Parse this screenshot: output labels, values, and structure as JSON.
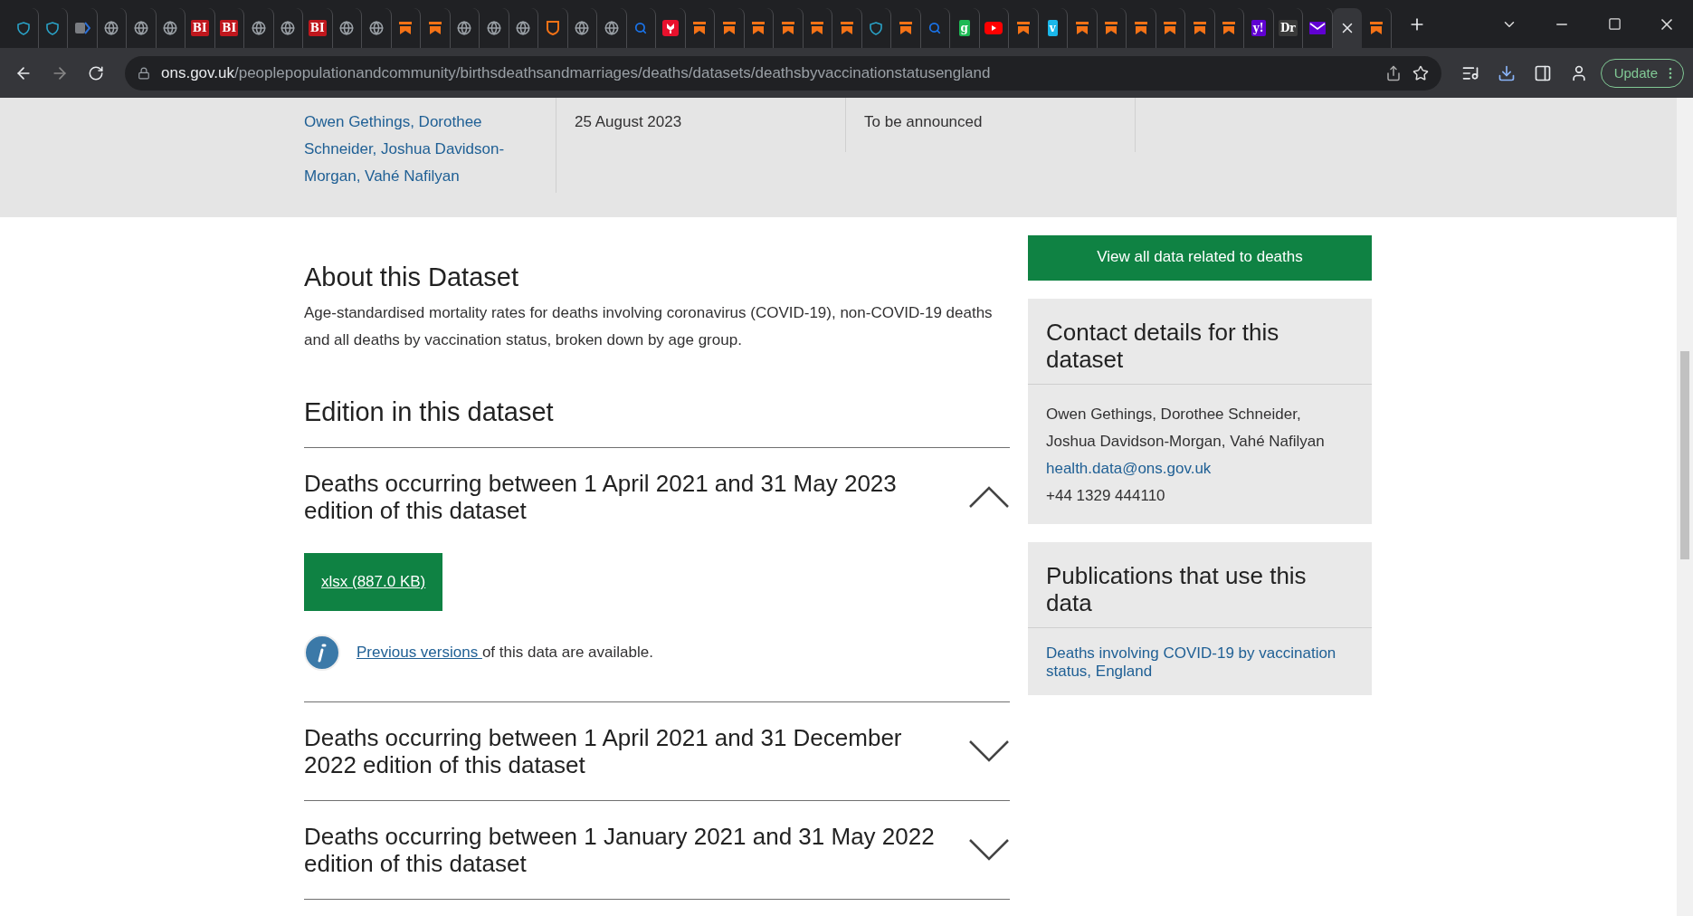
{
  "browser": {
    "tabs": [
      {
        "kind": "heart",
        "selected": false
      },
      {
        "kind": "heart",
        "selected": false
      },
      {
        "kind": "doc",
        "selected": false
      },
      {
        "kind": "globe",
        "selected": false
      },
      {
        "kind": "globe",
        "selected": false
      },
      {
        "kind": "globe",
        "selected": false
      },
      {
        "kind": "letters",
        "label": "BI",
        "selected": false
      },
      {
        "kind": "letters",
        "label": "BI",
        "selected": false
      },
      {
        "kind": "globe",
        "selected": false
      },
      {
        "kind": "globe",
        "selected": false
      },
      {
        "kind": "letters",
        "label": "BI",
        "selected": false
      },
      {
        "kind": "globe",
        "selected": false
      },
      {
        "kind": "globe",
        "selected": false
      },
      {
        "kind": "bookmark",
        "selected": false
      },
      {
        "kind": "bookmark",
        "selected": false
      },
      {
        "kind": "globe",
        "selected": false
      },
      {
        "kind": "globe",
        "selected": false
      },
      {
        "kind": "globe",
        "selected": false
      },
      {
        "kind": "shield",
        "selected": false
      },
      {
        "kind": "globe",
        "selected": false
      },
      {
        "kind": "globe",
        "selected": false
      },
      {
        "kind": "search",
        "selected": false
      },
      {
        "kind": "tulip",
        "selected": false
      },
      {
        "kind": "bookmark",
        "selected": false
      },
      {
        "kind": "bookmark",
        "selected": false
      },
      {
        "kind": "bookmark",
        "selected": false
      },
      {
        "kind": "bookmark",
        "selected": false
      },
      {
        "kind": "bookmark",
        "selected": false
      },
      {
        "kind": "bookmark",
        "selected": false
      },
      {
        "kind": "heart",
        "selected": false
      },
      {
        "kind": "bookmark",
        "selected": false
      },
      {
        "kind": "search",
        "selected": false
      },
      {
        "kind": "letters",
        "label": "g",
        "color": "#1db954",
        "selected": false
      },
      {
        "kind": "youtube",
        "selected": false
      },
      {
        "kind": "bookmark",
        "selected": false
      },
      {
        "kind": "letters",
        "label": "v",
        "color": "#1ab7ea",
        "selected": false
      },
      {
        "kind": "bookmark",
        "selected": false
      },
      {
        "kind": "bookmark",
        "selected": false
      },
      {
        "kind": "bookmark",
        "selected": false
      },
      {
        "kind": "bookmark",
        "selected": false
      },
      {
        "kind": "bookmark",
        "selected": false
      },
      {
        "kind": "bookmark",
        "selected": false
      },
      {
        "kind": "letters",
        "label": "y!",
        "color": "#6001d2",
        "selected": false
      },
      {
        "kind": "letters",
        "label": "Dr",
        "color": "#3a3a3a",
        "selected": false
      },
      {
        "kind": "mail",
        "selected": false
      },
      {
        "kind": "blank",
        "selected": true
      },
      {
        "kind": "bookmark",
        "selected": false
      }
    ],
    "address": {
      "domain": "ons.gov.uk",
      "path": "/peoplepopulationandcommunity/birthsdeathsandmarriages/deaths/datasets/deathsbyvaccinationstatusengland"
    },
    "update_button": "Update"
  },
  "meta": [
    {
      "kind": "link",
      "lines": [
        "Owen Gethings, Dorothee",
        "Schneider, Joshua Davidson-",
        "Morgan, Vahé Nafilyan"
      ]
    },
    {
      "kind": "text",
      "lines": [
        "25 August 2023"
      ]
    },
    {
      "kind": "text",
      "lines": [
        "To be announced"
      ]
    }
  ],
  "about": {
    "heading": "About this Dataset",
    "text": "Age-standardised mortality rates for deaths involving coronavirus (COVID-19), non-COVID-19 deaths and all deaths by vaccination status, broken down by age group."
  },
  "editions_heading": "Edition in this dataset",
  "editions": [
    {
      "title": "Deaths occurring between 1 April 2021 and 31 May 2023 edition of this dataset",
      "expanded": true,
      "download": "xlsx (887.0 KB)",
      "notice_link": "Previous versions ",
      "notice_text": "of this data are available."
    },
    {
      "title": "Deaths occurring between 1 April 2021 and 31 December 2022 edition of this dataset",
      "expanded": false
    },
    {
      "title": "Deaths occurring between 1 January 2021 and 31 May 2022 edition of this dataset",
      "expanded": false
    }
  ],
  "sidebar": {
    "button": "View all data related to deaths",
    "cards": [
      {
        "title": "Contact details for this dataset",
        "items": [
          {
            "kind": "text",
            "value": "Owen Gethings, Dorothee Schneider, Joshua Davidson-Morgan, Vahé Nafilyan"
          },
          {
            "kind": "link",
            "value": "health.data@ons.gov.uk"
          },
          {
            "kind": "text",
            "value": "+44 1329 444110"
          }
        ]
      },
      {
        "title": "Publications that use this data",
        "items": [
          {
            "kind": "link",
            "value": "Deaths involving COVID-19 by vaccination status, England"
          }
        ]
      }
    ]
  }
}
